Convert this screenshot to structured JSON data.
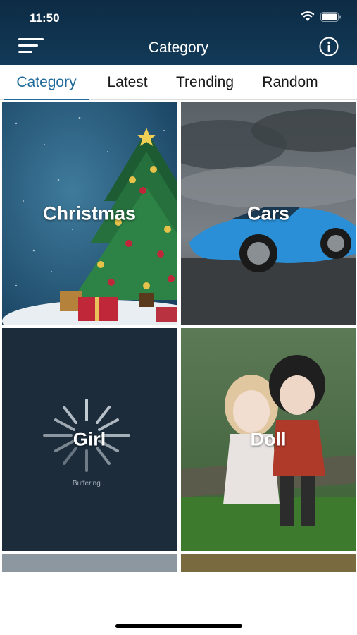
{
  "status_bar": {
    "time": "11:50"
  },
  "header": {
    "title": "Category"
  },
  "tabs": [
    {
      "label": "Category",
      "active": true
    },
    {
      "label": "Latest",
      "active": false
    },
    {
      "label": "Trending",
      "active": false
    },
    {
      "label": "Random",
      "active": false
    }
  ],
  "grid": {
    "tiles": [
      {
        "label": "Christmas"
      },
      {
        "label": "Cars"
      },
      {
        "label": "Girl",
        "loading_text": "Buffering..."
      },
      {
        "label": "Doll"
      }
    ]
  },
  "colors": {
    "header_bg": "#0f3250",
    "accent": "#1f6a9a"
  }
}
